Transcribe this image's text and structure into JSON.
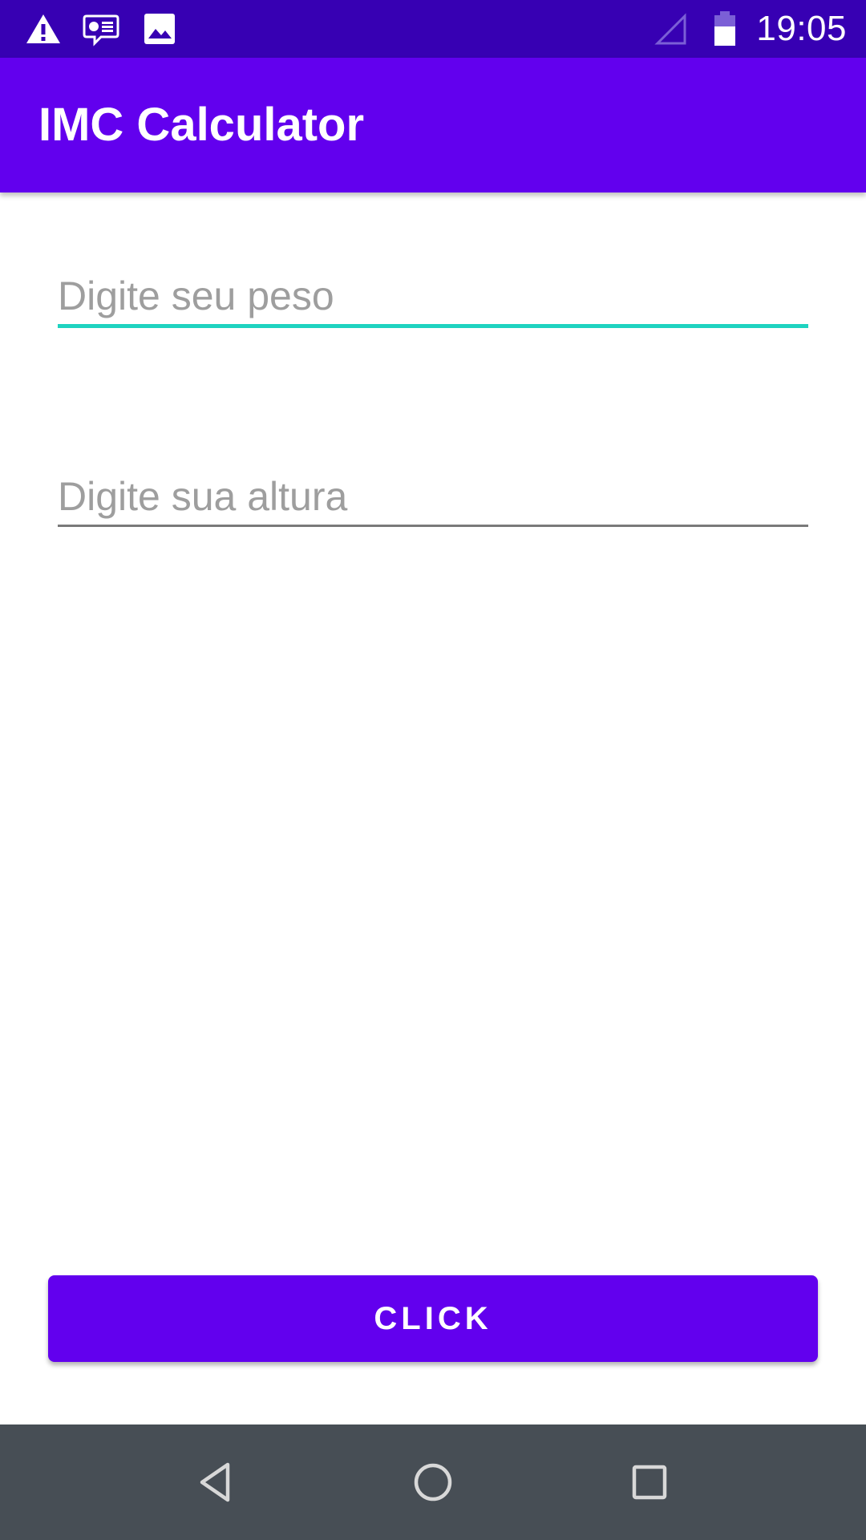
{
  "status_bar": {
    "time": "19:05",
    "icons": [
      "warning-icon",
      "message-icon",
      "image-icon",
      "signal-icon",
      "battery-icon"
    ]
  },
  "app_bar": {
    "title": "IMC Calculator"
  },
  "form": {
    "weight": {
      "placeholder": "Digite seu peso",
      "value": "",
      "focused": true
    },
    "height": {
      "placeholder": "Digite sua altura",
      "value": "",
      "focused": false
    }
  },
  "button": {
    "label": "CLICK"
  },
  "nav_bar": {
    "icons": [
      "back-icon",
      "home-icon",
      "recents-icon"
    ]
  },
  "colors": {
    "status_bar": "#3700b3",
    "primary": "#6200ee",
    "accent": "#1ed3c0",
    "nav_bar": "#474e55"
  }
}
